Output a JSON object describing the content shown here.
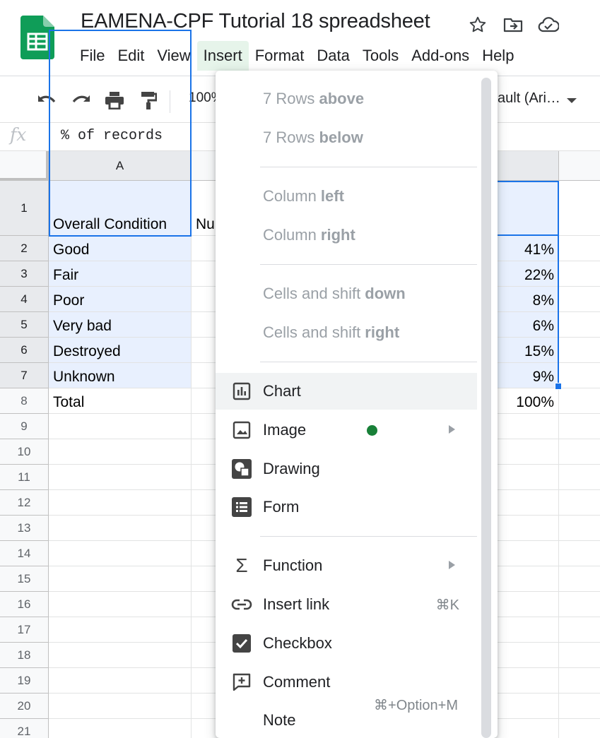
{
  "app": {
    "title": "EAMENA-CPF Tutorial 18 spreadsheet",
    "title_icons": [
      "star-icon",
      "move-to-folder-icon",
      "cloud-saved-icon"
    ],
    "brand_color": "#0f9d58"
  },
  "menubar": {
    "items": [
      "File",
      "Edit",
      "View",
      "Insert",
      "Format",
      "Data",
      "Tools",
      "Add-ons",
      "Help"
    ],
    "active": "Insert"
  },
  "toolbar": {
    "icons": [
      "undo-icon",
      "redo-icon",
      "print-icon",
      "paint-format-icon"
    ],
    "zoom": "100%",
    "font": "ault (Ari…"
  },
  "formula_bar": {
    "fx_label": "fx",
    "value": "% of records"
  },
  "sheet": {
    "columns": [
      "A",
      ""
    ],
    "rows": [
      "1",
      "2",
      "3",
      "4",
      "5",
      "6",
      "7",
      "8",
      "9",
      "10",
      "11",
      "12",
      "13",
      "14",
      "15",
      "16",
      "17",
      "18",
      "19",
      "20",
      "21"
    ],
    "col_a": [
      "Overall Condition",
      "Good",
      "Fair",
      "Poor",
      "Very bad",
      "Destroyed",
      "Unknown",
      "Total"
    ],
    "col_b_partial": "Nu",
    "col_c": [
      "",
      "41%",
      "22%",
      "8%",
      "6%",
      "15%",
      "9%",
      "100%"
    ]
  },
  "insert_menu": {
    "rows_above": {
      "count": "7 Rows ",
      "bold": "above"
    },
    "rows_below": {
      "count": "7 Rows ",
      "bold": "below"
    },
    "column_left": {
      "prefix": "Column ",
      "bold": "left"
    },
    "column_right": {
      "prefix": "Column ",
      "bold": "right"
    },
    "cells_down": {
      "prefix": "Cells and shift ",
      "bold": "down"
    },
    "cells_right": {
      "prefix": "Cells and shift ",
      "bold": "right"
    },
    "chart": "Chart",
    "image": "Image",
    "drawing": "Drawing",
    "form": "Form",
    "function": "Function",
    "insert_link": "Insert link",
    "insert_link_shortcut": "⌘K",
    "checkbox": "Checkbox",
    "comment": "Comment",
    "comment_shortcut": "⌘+Option+M",
    "note": "Note"
  }
}
